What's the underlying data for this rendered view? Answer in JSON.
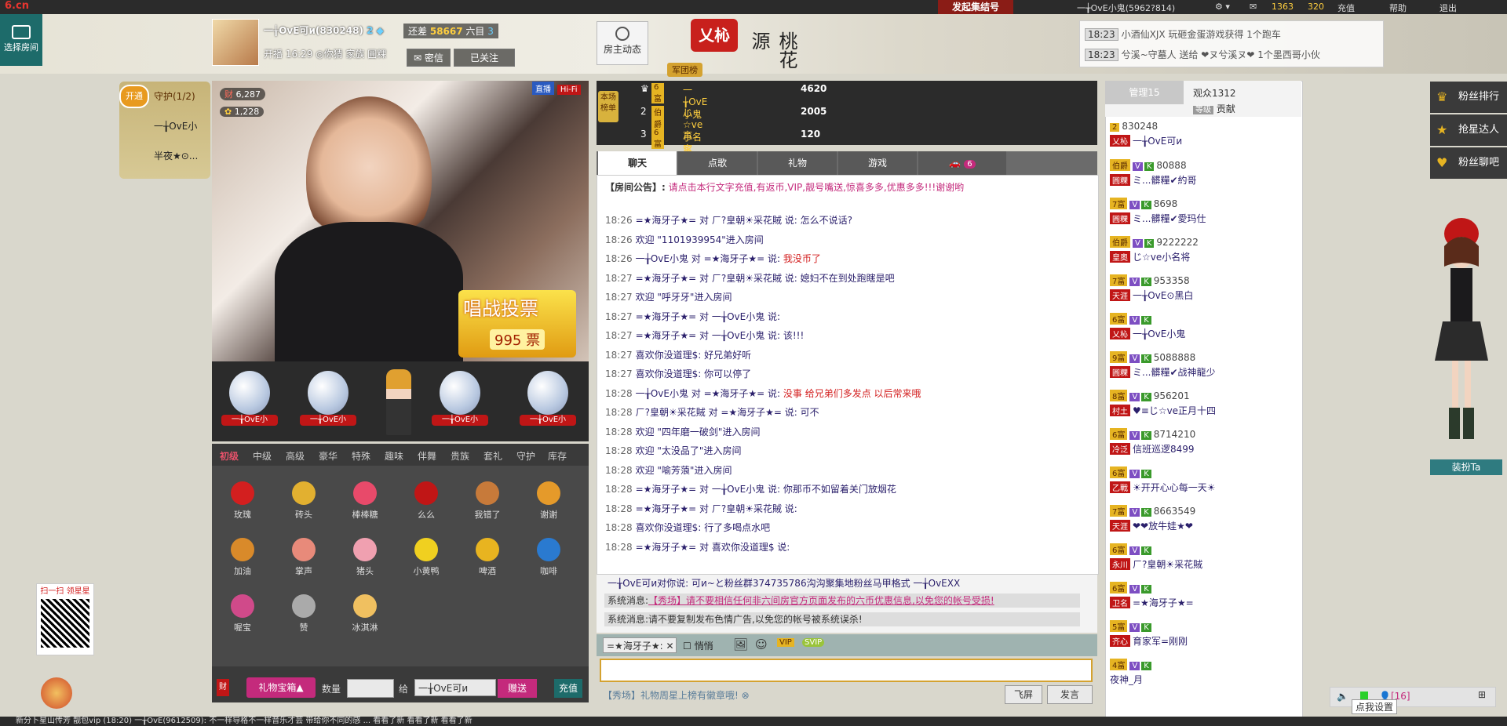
{
  "topbar": {
    "logo": "6.cn",
    "launch_label": "发起集结号",
    "user": "一╁OvE小鬼(5962?814)",
    "coins": "1363",
    "beans": "320",
    "recharge": "充值",
    "help": "帮助",
    "logout": "退出"
  },
  "header": {
    "select_room": "选择房间",
    "anchor_name": "一╁OvE可и(830248)",
    "anchor_level": "2",
    "anchor_meta": "开播 16:29  ◎你猜  家族 圓粿",
    "rank_gap_prefix": "还差",
    "rank_gap_num": "58667",
    "rank_gap_suffix": "六目",
    "rank_gap_level": "3",
    "private_msg": "密信",
    "follow": "已关注",
    "owner_dynamic": "房主动态",
    "brand_logo": "乂杺",
    "brand_title": "桃花源",
    "army_tag": "军团榜"
  },
  "ticker": [
    {
      "time": "18:23",
      "text": "小酒仙XJX 玩砸金蛋游戏获得 1个跑车"
    },
    {
      "time": "18:23",
      "text": "兮溪~守墓人 送给 ❤ヌ兮溪ヌ❤ 1个墨西哥小伙"
    }
  ],
  "guard": {
    "open": "开通",
    "title": "守护(1/2)",
    "members": [
      "一╁OvE小",
      "半夜★⊙..."
    ]
  },
  "video": {
    "live_tag": "直播",
    "hifi_tag": "Hi-Fi",
    "money": "6,287",
    "flowers": "1,228",
    "vote_title": "唱战投票",
    "vote_count": "995 票"
  },
  "seats": [
    "一╁OvE小",
    "一╁OvE小",
    "一╁OvE小",
    "一╁OvE小"
  ],
  "gift_tabs": [
    "初级",
    "中级",
    "高级",
    "豪华",
    "特殊",
    "趣味",
    "伴舞",
    "贵族",
    "套礼",
    "守护",
    "库存"
  ],
  "gifts": [
    {
      "name": "玫瑰",
      "color": "#d31f1f"
    },
    {
      "name": "砖头",
      "color": "#e2b030"
    },
    {
      "name": "棒棒糖",
      "color": "#e84a6a"
    },
    {
      "name": "么么",
      "color": "#c01616"
    },
    {
      "name": "我错了",
      "color": "#c77a3a"
    },
    {
      "name": "谢谢",
      "color": "#e59a2a"
    },
    {
      "name": "加油",
      "color": "#d98a2a"
    },
    {
      "name": "掌声",
      "color": "#e88a7a"
    },
    {
      "name": "猪头",
      "color": "#f0a0b0"
    },
    {
      "name": "小黄鸭",
      "color": "#f0d020"
    },
    {
      "name": "啤酒",
      "color": "#e8b420"
    },
    {
      "name": "咖啡",
      "color": "#2a7ad0"
    },
    {
      "name": "喔宝",
      "color": "#d04a8a"
    },
    {
      "name": "赞",
      "color": "#aaaaaa"
    },
    {
      "name": "冰淇淋",
      "color": "#f0c060"
    }
  ],
  "gift_bar": {
    "cai": "财",
    "gift_box": "礼物宝箱▲",
    "qty_label": "数量",
    "to_label": "给",
    "to_target": "一╁OvE可и",
    "send": "赠送",
    "recharge": "充值"
  },
  "rank": {
    "label": "本场榜单",
    "rows": [
      {
        "no": "1",
        "lv": "6富",
        "name": "一╁OvE小鬼",
        "value": "4620"
      },
      {
        "no": "2",
        "lv": "伯爵",
        "name": "じ☆ve小名将",
        "value": "2005"
      },
      {
        "no": "3",
        "lv": "6富",
        "name": "育家军=司令",
        "value": "120"
      }
    ]
  },
  "chat_tabs": [
    "聊天",
    "点歌",
    "礼物",
    "游戏",
    "6"
  ],
  "announce_prefix": "【房间公告】:",
  "announce": "请点击本行文字充值,有返币,VIP,靓号嘴送,惊喜多多,优惠多多!!!谢谢哟",
  "messages": [
    {
      "time": "18:26",
      "text": "=★海牙子★= 对 ㄏ?皇朝☀采花賊 说: 怎么不说话?"
    },
    {
      "time": "18:26",
      "text": "欢迎 \"1101939954\"进入房间"
    },
    {
      "time": "18:26",
      "text": "一╁OvE小鬼 对 =★海牙子★= 说: ",
      "red": "我没币了"
    },
    {
      "time": "18:27",
      "text": "=★海牙子★= 对 ㄏ?皇朝☀采花賊 说: 媳妇不在到处跑瞎是吧"
    },
    {
      "time": "18:27",
      "text": "欢迎 \"呼牙牙\"进入房间"
    },
    {
      "time": "18:27",
      "text": "=★海牙子★= 对 一╁OvE小鬼 说: "
    },
    {
      "time": "18:27",
      "text": "=★海牙子★= 对 一╁OvE小鬼 说: 该!!!"
    },
    {
      "time": "18:27",
      "text": "喜欢你没道理$: 好兄弟好听"
    },
    {
      "time": "18:27",
      "text": "喜欢你没道理$: 你可以停了"
    },
    {
      "time": "18:28",
      "text": "一╁OvE小鬼 对 =★海牙子★= 说: ",
      "red": "没事 给兄弟们多发点 以后常来哦"
    },
    {
      "time": "18:28",
      "text": "ㄏ?皇朝☀采花賊 对 =★海牙子★= 说: 可不"
    },
    {
      "time": "18:28",
      "text": "欢迎 \"四年磨一破剑\"进入房间"
    },
    {
      "time": "18:28",
      "text": "欢迎 \"太没品了\"进入房间"
    },
    {
      "time": "18:28",
      "text": "欢迎 \"喻芳蒗\"进入房间"
    },
    {
      "time": "18:28",
      "text": "=★海牙子★= 对 一╁OvE小鬼 说: 你那币不如留着关门放烟花"
    },
    {
      "time": "18:28",
      "text": "=★海牙子★= 对 ㄏ?皇朝☀采花賊 说: "
    },
    {
      "time": "18:28",
      "text": "喜欢你没道理$: 行了多喝点水吧"
    },
    {
      "time": "18:28",
      "text": "=★海牙子★= 对 喜欢你没道理$ 说: "
    }
  ],
  "private": {
    "line1": "一╁OvE可и对你说: 可и~と粉丝群374735786沟沟聚集地粉丝马甲格式 一╁OvEXX",
    "sys_label": "系统消息:",
    "sys1": "【秀场】请不要相信任何非六间房官方页面发布的六币优惠信息,以免您的帐号受损!",
    "sys2": "请不要复制发布色情广告,以免您的帐号被系统误杀!"
  },
  "input": {
    "target": "=★海牙子★:",
    "whisper": "悄悄",
    "tip": "【秀场】礼物周星上榜有徽章哦!",
    "fly": "飞屏",
    "send": "发言"
  },
  "userlist": {
    "admin_tab": "管理15",
    "audience": "观众1312",
    "contrib_tag": "等级",
    "contrib": "贡献",
    "rows": [
      {
        "id": "830248",
        "name": "一╁OvE可и"
      },
      {
        "id": "80888",
        "name": "ミ...髒糧✔約哥"
      },
      {
        "id": "8698",
        "name": "ミ...髒糧✔愛玛仕"
      },
      {
        "id": "9222222",
        "name": "じ☆ve小名将"
      },
      {
        "id": "953358",
        "name": "一╁OvE⊙黑白"
      },
      {
        "id": "",
        "name": "一╁OvE小鬼"
      },
      {
        "id": "5088888",
        "name": "ミ...髒糧✔战神龍少"
      },
      {
        "id": "956201",
        "name": "♥≡じ☆ve正月十四"
      },
      {
        "id": "8714210",
        "name": "信班巡逻8499"
      },
      {
        "id": "",
        "name": "☀开开心心每一天☀"
      },
      {
        "id": "8663549",
        "name": "❤❤放牛娃★❤"
      },
      {
        "id": "",
        "name": "ㄏ?皇朝☀采花賊"
      },
      {
        "id": "",
        "name": "=★海牙子★="
      },
      {
        "id": "",
        "name": "育家军=刚刚"
      },
      {
        "id": "",
        "name": "夜神_月"
      }
    ]
  },
  "side": {
    "fans_rank": "粉丝排行",
    "grab_master": "抢星达人",
    "fans_bar": "粉丝聊吧",
    "dress": "装扮Ta"
  },
  "qr": {
    "label": "扫一扫 领星星"
  },
  "bottom": {
    "tools_count": "[16]",
    "settings_tip": "点我设置",
    "marquee": "新分卜星山传芳 靓包vip (18:20)  一╁OvE(9612509): 不一样导格不一样音乐才芸 带给你不同的感 ... 看看了新 看看了新 看看了新"
  }
}
